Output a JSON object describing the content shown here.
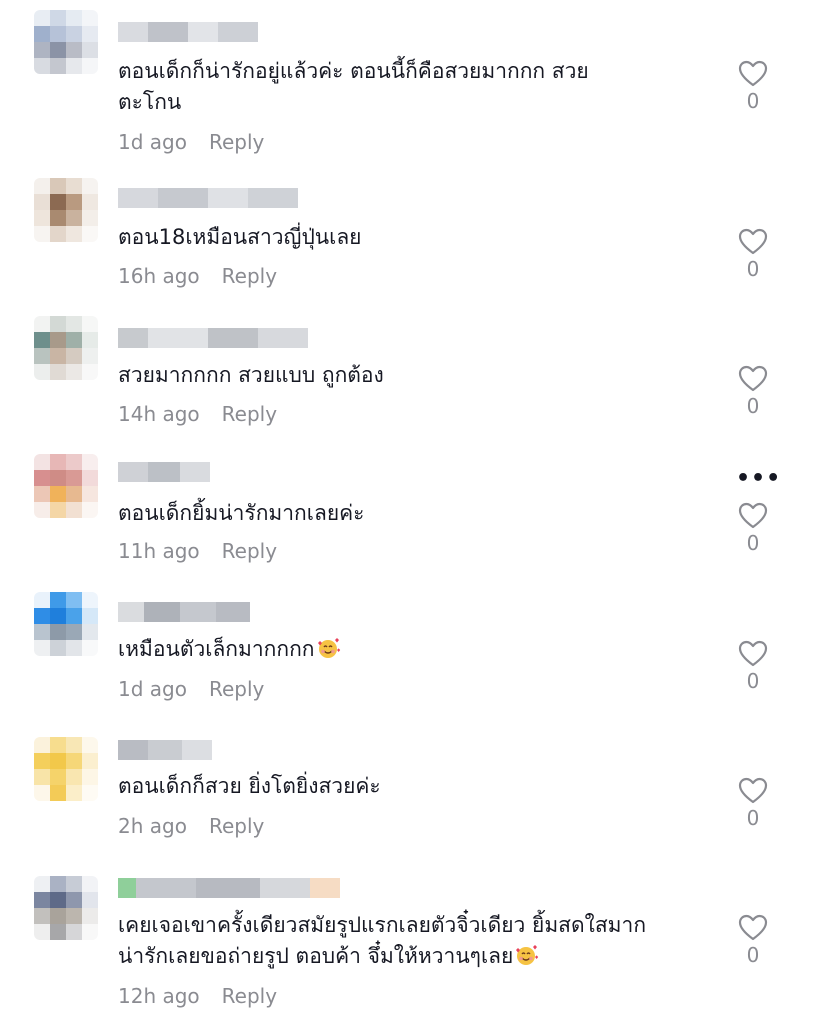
{
  "comments": [
    {
      "text": "ตอนเด็กก็น่ารักอยู่แล้วค่ะ ตอนนี้ก็คือสวยมากกก สวย\nตะโกน",
      "time": "1d ago",
      "reply": "Reply",
      "likes": "0"
    },
    {
      "text": "ตอน18เหมือนสาวญี่ปุ่นเลย",
      "time": "16h ago",
      "reply": "Reply",
      "likes": "0"
    },
    {
      "text": "สวยมากกกก สวยแบบ ถูกต้อง",
      "time": "14h ago",
      "reply": "Reply",
      "likes": "0"
    },
    {
      "text": "ตอนเด็กยิ้มน่ารักมากเลยค่ะ",
      "time": "11h ago",
      "reply": "Reply",
      "likes": "0"
    },
    {
      "text": "เหมือนตัวเล็กมากกกก",
      "time": "1d ago",
      "reply": "Reply",
      "likes": "0"
    },
    {
      "text": "ตอนเด็กก็สวย ยิ่งโตยิ่งสวยค่ะ",
      "time": "2h ago",
      "reply": "Reply",
      "likes": "0"
    },
    {
      "text": "เคยเจอเขาครั้งเดียวสมัยรูปแรกเลยตัวจิ๋วเดียว ยิ้มสดใสมาก\nน่ารักเลยขอถ่ายรูป ตอบค้า จึ๋มให้หวานๆเลย",
      "time": "12h ago",
      "reply": "Reply",
      "likes": "0"
    }
  ],
  "more_icon": "ellipsis-icon",
  "like_icon": "heart-outline-icon",
  "emoji_icon": "smiling-face-with-hearts-icon"
}
